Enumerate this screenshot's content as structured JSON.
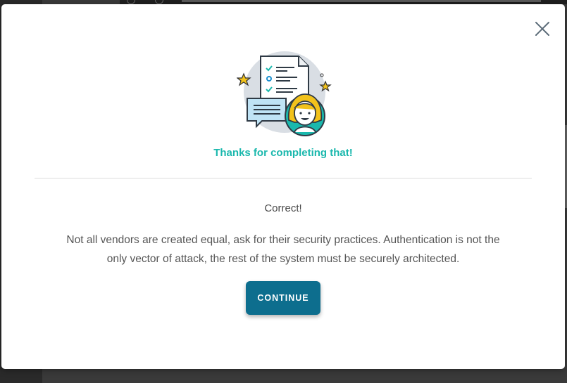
{
  "modal": {
    "title": "Thanks for completing that!",
    "result": "Correct!",
    "feedback": "Not all vendors are created equal, ask for their security practices. Authentication is not the only vector of attack, the rest of the system must be securely architected.",
    "continue_label": "CONTINUE",
    "close_icon": "close-icon",
    "illustration_icon": "completion-illustration"
  },
  "colors": {
    "title": "#1ab8ad",
    "button": "#0d6e8e",
    "overlay": "#3a3a3a"
  }
}
